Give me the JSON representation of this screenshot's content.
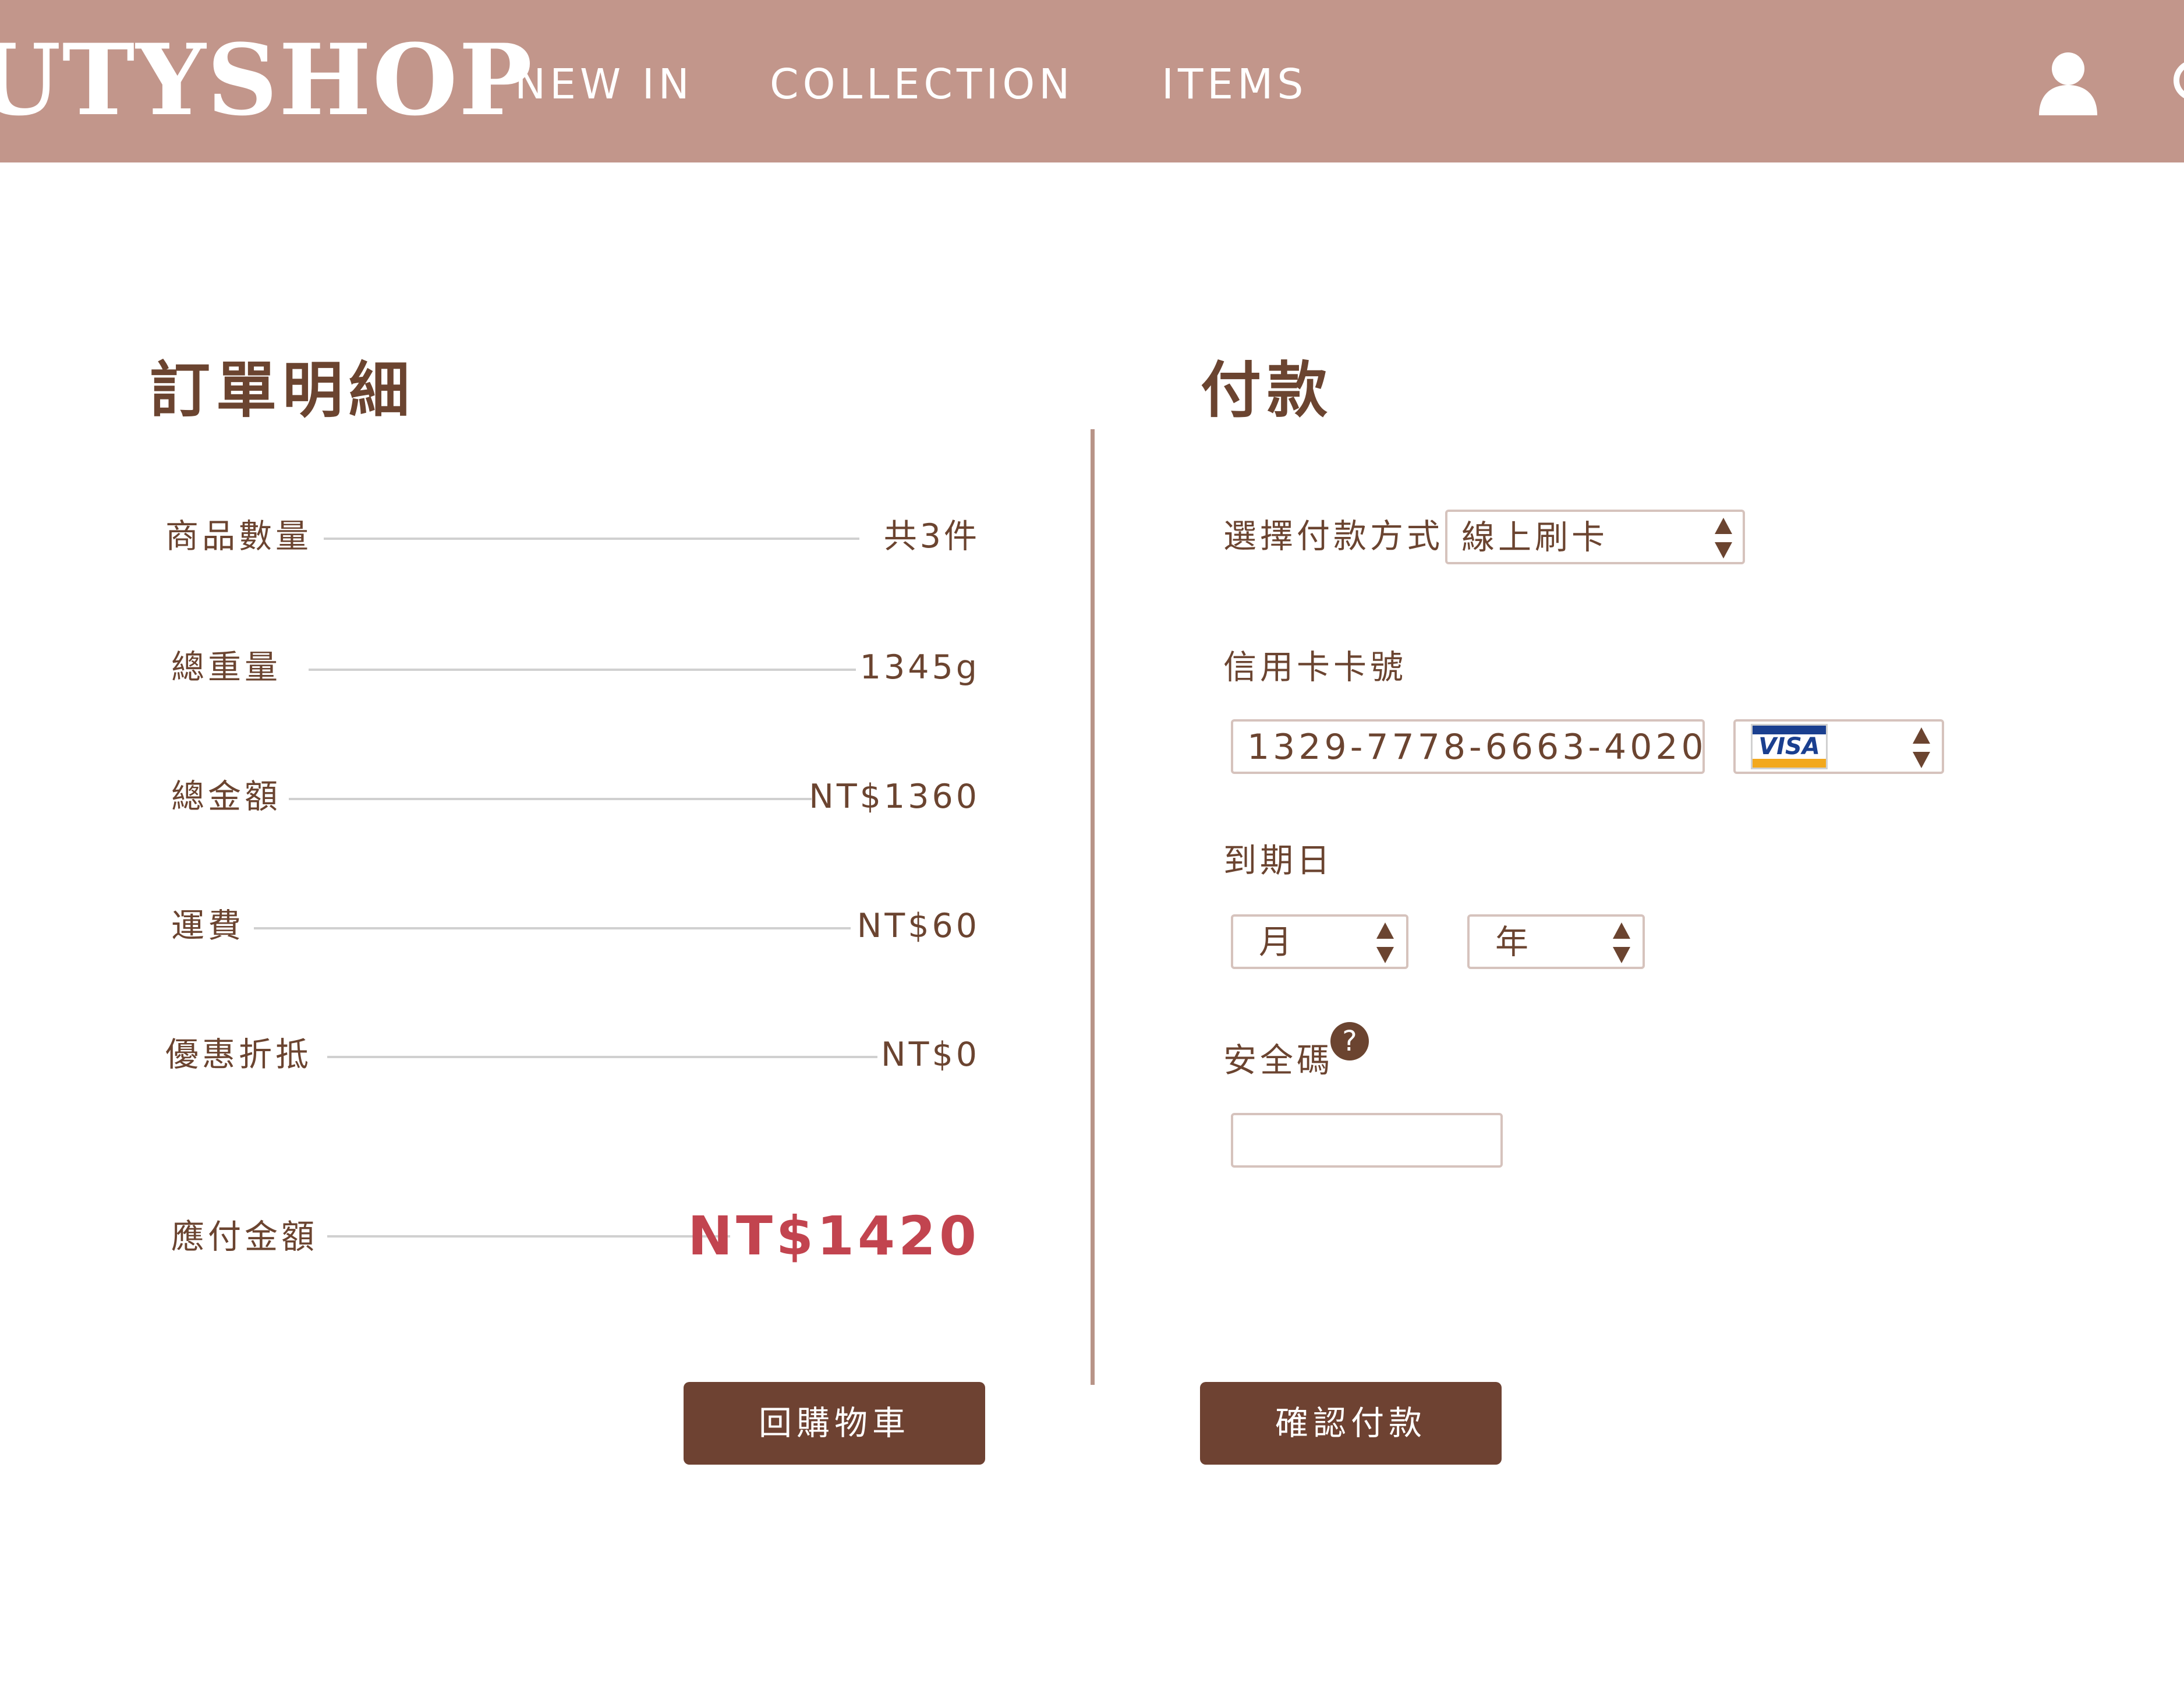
{
  "header": {
    "logo": "UTYSHOP",
    "nav": [
      "NEW IN",
      "COLLECTION",
      "ITEMS"
    ],
    "icons": [
      "user-icon",
      "search-icon"
    ]
  },
  "order": {
    "title": "訂單明細",
    "rows": [
      {
        "label": "商品數量",
        "value": "共3件"
      },
      {
        "label": "總重量",
        "value": "1345g"
      },
      {
        "label": "總金額",
        "value": "NT$1360"
      },
      {
        "label": "運費",
        "value": "NT$60"
      },
      {
        "label": "優惠折抵",
        "value": "NT$0"
      }
    ],
    "due": {
      "label": "應付金額",
      "value": "NT$1420"
    },
    "back_button": "回購物車"
  },
  "payment": {
    "title": "付款",
    "method_label": "選擇付款方式",
    "method_value": "線上刷卡",
    "card_label": "信用卡卡號",
    "card_number": "1329-7778-6663-4020",
    "card_brand": "VISA",
    "expiry_label": "到期日",
    "expiry_month": "月",
    "expiry_year": "年",
    "cvv_label": "安全碼",
    "cvv_help": "?",
    "cvv_value": "",
    "confirm_button": "確認付款"
  },
  "colors": {
    "header_bg": "#c2968b",
    "brand_brown": "#6e4232",
    "due_red": "#c2444f"
  }
}
